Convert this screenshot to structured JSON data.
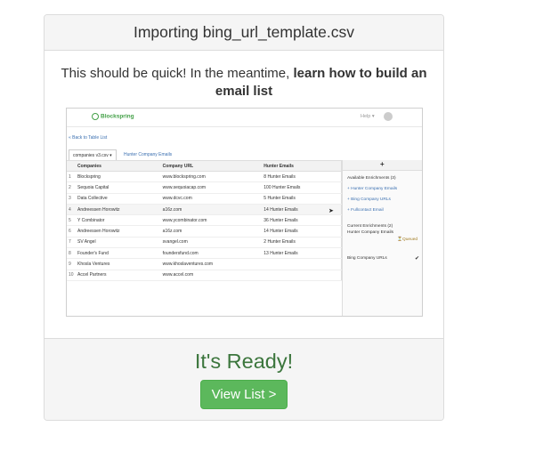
{
  "header": {
    "title": "Importing bing_url_template.csv"
  },
  "intro": {
    "text": "This should be quick! In the meantime, ",
    "link_text": "learn how to build an email list"
  },
  "preview": {
    "brand": "Blockspring",
    "help": "Help ▾",
    "back_link": "« Back to Table List",
    "tabs": [
      "companies v3.csv ▾",
      "Hunter Company Emails"
    ],
    "columns": [
      "Companies",
      "Company URL",
      "Hunter Emails"
    ],
    "rows": [
      [
        "1",
        "Blockspring",
        "www.blockspring.com",
        "8 Hunter Emails"
      ],
      [
        "2",
        "Sequoia Capital",
        "www.sequoiacap.com",
        "100 Hunter Emails"
      ],
      [
        "3",
        "Data Collective",
        "www.dcvc.com",
        "5 Hunter Emails"
      ],
      [
        "4",
        "Andreessen Horowitz",
        "a16z.com",
        "14 Hunter Emails"
      ],
      [
        "5",
        "Y Combinator",
        "www.ycombinator.com",
        "36 Hunter Emails"
      ],
      [
        "6",
        "Andreessen Horowitz",
        "a16z.com",
        "14 Hunter Emails"
      ],
      [
        "7",
        "SV Angel",
        "svangel.com",
        "2 Hunter Emails"
      ],
      [
        "8",
        "Founder's Fund",
        "foundersfund.com",
        "13 Hunter Emails"
      ],
      [
        "9",
        "Khosla Ventures",
        "www.khoslaventures.com",
        ""
      ],
      [
        "10",
        "Accel Partners",
        "www.accel.com",
        ""
      ]
    ],
    "side": {
      "plus": "+",
      "available_heading": "Available Enrichments (3)",
      "available": [
        "Hunter Company Emails",
        "Bing Company URLs",
        "Fullcontact Email"
      ],
      "current_heading": "Current Enrichments (2)",
      "current_item": "Hunter Company Emails",
      "queued": "Queued",
      "bing": "Bing Company URLs"
    }
  },
  "footer": {
    "status": "It's Ready!",
    "button_label": "View List >"
  },
  "colors": {
    "ready": "#3c763d",
    "button": "#5cb85c"
  }
}
